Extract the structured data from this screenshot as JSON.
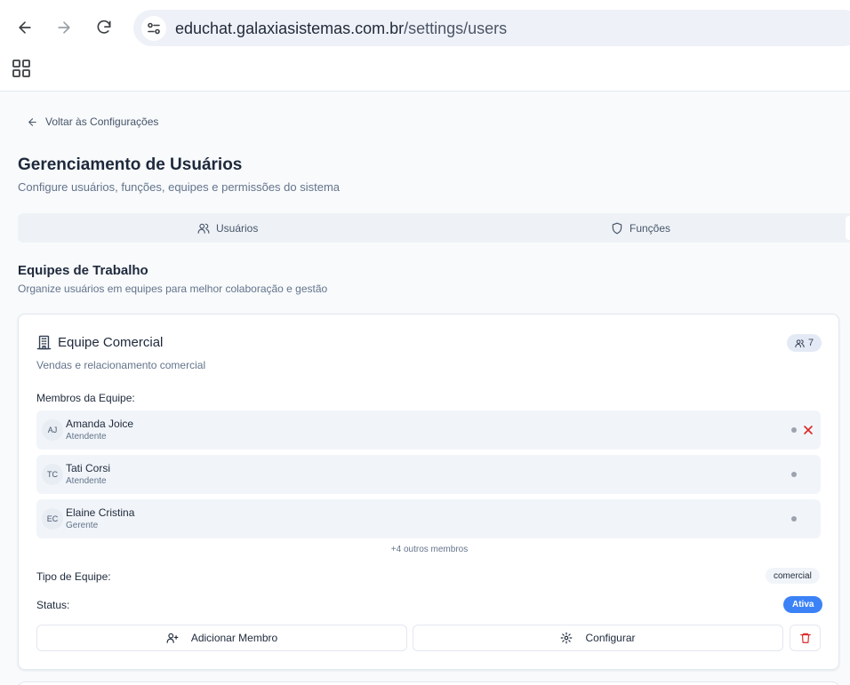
{
  "browser": {
    "url_domain": "educhat.galaxiasistemas.com.br",
    "url_path": "/settings/users"
  },
  "page": {
    "back_link": "Voltar às Configurações",
    "title": "Gerenciamento de Usuários",
    "subtitle": "Configure usuários, funções, equipes e permissões do sistema"
  },
  "tabs": [
    {
      "label": "Usuários",
      "icon": "users-icon"
    },
    {
      "label": "Funções",
      "icon": "shield-icon"
    }
  ],
  "section": {
    "title": "Equipes de Trabalho",
    "subtitle": "Organize usuários em equipes para melhor colaboração e gestão"
  },
  "team": {
    "name": "Equipe Comercial",
    "icon": "building-icon",
    "member_count": "7",
    "description": "Vendas e relacionamento comercial",
    "members_label": "Membros da Equipe:",
    "members": [
      {
        "initials": "AJ",
        "name": "Amanda Joice",
        "role": "Atendente"
      },
      {
        "initials": "TC",
        "name": "Tati Corsi",
        "role": "Atendente"
      },
      {
        "initials": "EC",
        "name": "Elaine Cristina",
        "role": "Gerente"
      }
    ],
    "more_members": "+4 outros membros",
    "type_label": "Tipo de Equipe:",
    "type_value": "comercial",
    "status_label": "Status:",
    "status_value": "Ativa",
    "add_member_label": "Adicionar Membro",
    "configure_label": "Configurar"
  },
  "colors": {
    "accent": "#3b82f6",
    "danger": "#dc2626"
  }
}
